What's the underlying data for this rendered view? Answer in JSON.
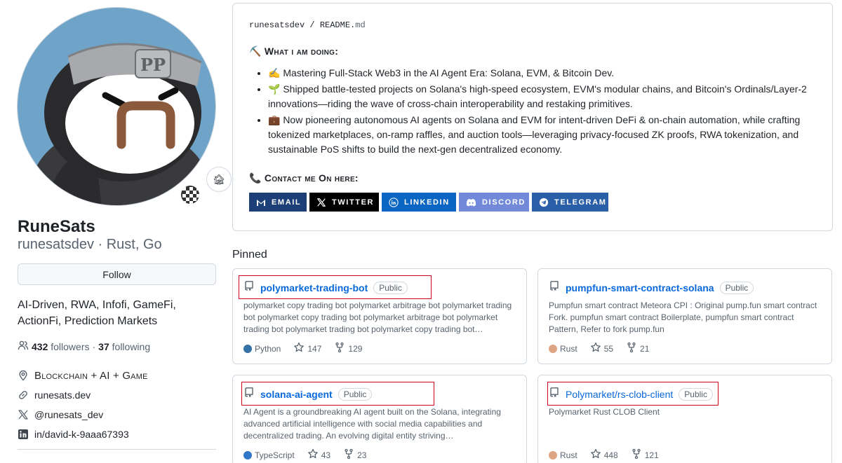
{
  "profile": {
    "name": "RuneSats",
    "login_line": "runesatsdev · Rust, Go",
    "status_emoji": "🏚",
    "follow_label": "Follow",
    "bio": "AI-Driven, RWA, Infofi, GameFi, ActionFi, Prediction Markets",
    "followers_count": "432",
    "followers_label": "followers",
    "separator": "·",
    "following_count": "37",
    "following_label": "following",
    "location": "Blockchain + AI + Game",
    "website": "runesats.dev",
    "twitter": "@runesats_dev",
    "linkedin": "in/david-k-9aaa67393"
  },
  "readme": {
    "path_owner": "runesatsdev",
    "path_sep": "/",
    "path_file": "README.",
    "path_ext": "md",
    "doing_heading": "⛏️ What i am doing:",
    "doing_items": [
      "✍️ Mastering Full-Stack Web3 in the AI Agent Era: Solana, EVM, & Bitcoin Dev.",
      "🌱 Shipped battle-tested projects on Solana's high-speed ecosystem, EVM's modular chains, and Bitcoin's Ordinals/Layer-2 innovations—riding the wave of cross-chain interoperability and restaking primitives.",
      "💼 Now pioneering autonomous AI agents on Solana and EVM for intent-driven DeFi & on-chain automation, while crafting tokenized marketplaces, on-ramp raffles, and auction tools—leveraging privacy-focused ZK proofs, RWA tokenization, and sustainable PoS shifts to build the next-gen decentralized economy."
    ],
    "contact_heading": "📞 Contact me On here:",
    "badges": [
      {
        "label": "EMAIL",
        "icon": "gmail-icon",
        "color": "#1c3f77"
      },
      {
        "label": "TWITTER",
        "icon": "x-icon",
        "color": "#000000"
      },
      {
        "label": "LINKEDIN",
        "icon": "linkedin-icon",
        "color": "#0a66c2"
      },
      {
        "label": "DISCORD",
        "icon": "discord-icon",
        "color": "#7289da"
      },
      {
        "label": "TELEGRAM",
        "icon": "telegram-icon",
        "color": "#2a5fa8"
      }
    ]
  },
  "pinned": {
    "title": "Pinned",
    "repos": [
      {
        "name": "polymarket-trading-bot",
        "visibility": "Public",
        "description": "polymarket copy trading bot polymarket arbitrage bot polymarket trading bot polymarket copy trading bot polymarket arbitrage bot polymarket trading bot polymarket trading bot polymarket copy trading bot polymarket arbitrage bot",
        "language": "Python",
        "language_color": "#3572A5",
        "stars": "147",
        "forks": "129"
      },
      {
        "name": "pumpfun-smart-contract-solana",
        "visibility": "Public",
        "description": "Pumpfun smart contract Meteora CPI : Original pump.fun smart contract Fork. pumpfun smart contract Boilerplate, pumpfun smart contract Pattern, Refer to fork pump.fun",
        "language": "Rust",
        "language_color": "#dea584",
        "stars": "55",
        "forks": "21"
      },
      {
        "name": "solana-ai-agent",
        "visibility": "Public",
        "description": "AI Agent is a groundbreaking AI agent built on the Solana, integrating advanced artificial intelligence with social media capabilities and decentralized trading. An evolving digital entity striving…",
        "language": "TypeScript",
        "language_color": "#3178c6",
        "stars": "43",
        "forks": "23"
      },
      {
        "name": "Polymarket/rs-clob-client",
        "visibility": "Public",
        "description": "Polymarket Rust CLOB Client",
        "language": "Rust",
        "language_color": "#dea584",
        "stars": "448",
        "forks": "121"
      }
    ]
  },
  "colors": {
    "link": "#0969da",
    "muted": "#59636e",
    "border": "#d1d9e0",
    "highlight_box": "#d0021b"
  }
}
